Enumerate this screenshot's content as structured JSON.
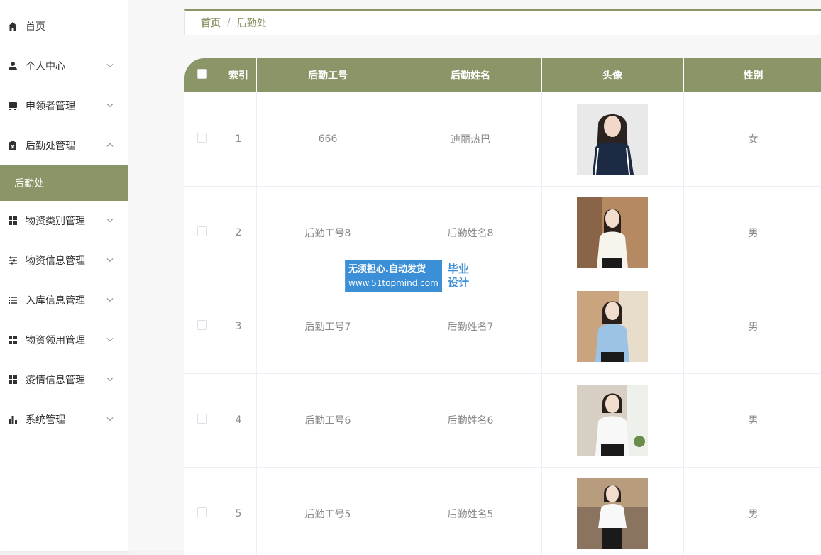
{
  "menu": {
    "home": "首页",
    "personal": "个人中心",
    "applicant": "申领者管理",
    "logistics": "后勤处管理",
    "logistics_sub": "后勤处",
    "category": "物资类别管理",
    "material_info": "物资信息管理",
    "stock_in": "入库信息管理",
    "material_use": "物资领用管理",
    "epidemic": "疫情信息管理",
    "system": "系统管理"
  },
  "breadcrumb": {
    "home": "首页",
    "separator": "/",
    "current": "后勤处"
  },
  "table": {
    "headers": {
      "index": "索引",
      "staff_no": "后勤工号",
      "staff_name": "后勤姓名",
      "avatar": "头像",
      "gender": "性别"
    },
    "rows": [
      {
        "index": "1",
        "staff_no": "666",
        "staff_name": "迪丽热巴",
        "gender": "女"
      },
      {
        "index": "2",
        "staff_no": "后勤工号8",
        "staff_name": "后勤姓名8",
        "gender": "男"
      },
      {
        "index": "3",
        "staff_no": "后勤工号7",
        "staff_name": "后勤姓名7",
        "gender": "男"
      },
      {
        "index": "4",
        "staff_no": "后勤工号6",
        "staff_name": "后勤姓名6",
        "gender": "男"
      },
      {
        "index": "5",
        "staff_no": "后勤工号5",
        "staff_name": "后勤姓名5",
        "gender": "男"
      }
    ]
  },
  "watermark": {
    "line1": "无须担心.自动发货",
    "url": "www.51topmind.com",
    "right1": "毕业",
    "right2": "设计"
  },
  "colors": {
    "accent": "#8a9668",
    "watermark_blue": "#3b8fd6"
  }
}
